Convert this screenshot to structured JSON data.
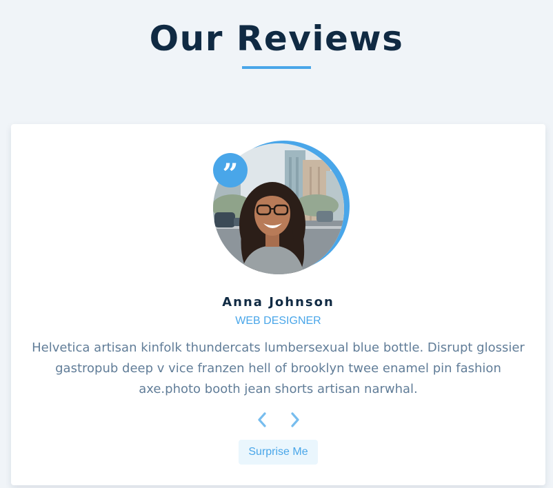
{
  "header": {
    "title": "Our Reviews"
  },
  "review": {
    "author": "Anna Johnson",
    "job": "WEB DESIGNER",
    "text": "Helvetica artisan kinfolk thundercats lumbersexual blue bottle. Disrupt glossier gastropub deep v vice franzen hell of brooklyn twee enamel pin fashion axe.photo booth jean shorts artisan narwhal.",
    "quote_glyph": "”",
    "image_icon": "person-photo"
  },
  "controls": {
    "prev_icon": "chevron-left-icon",
    "next_icon": "chevron-right-icon",
    "random_label": "Surprise Me"
  },
  "colors": {
    "accent": "#49a6e9",
    "heading": "#102a43",
    "body_text": "#617d98",
    "background": "#f0f4f8",
    "button_bg": "#eaf6fd"
  }
}
